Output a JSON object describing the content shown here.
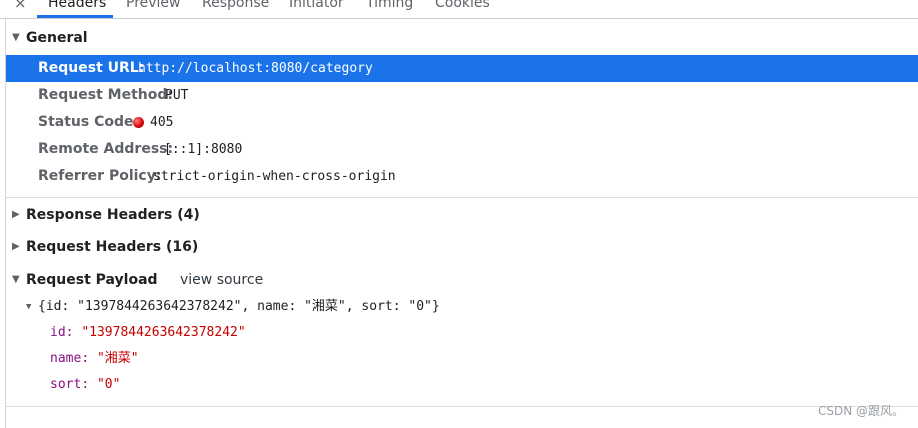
{
  "tabs": [
    {
      "label": "Headers",
      "active": true
    },
    {
      "label": "Preview",
      "active": false
    },
    {
      "label": "Response",
      "active": false
    },
    {
      "label": "Initiator",
      "active": false
    },
    {
      "label": "Timing",
      "active": false
    },
    {
      "label": "Cookies",
      "active": false
    }
  ],
  "close_glyph": "×",
  "general": {
    "title": "General",
    "rows": [
      {
        "key": "Request URL:",
        "value": "http://localhost:8080/category"
      },
      {
        "key": "Request Method:",
        "value": "PUT"
      },
      {
        "key": "Status Code:",
        "value": "405",
        "status_color": "#d30000"
      },
      {
        "key": "Remote Address:",
        "value": "[::1]:8080"
      },
      {
        "key": "Referrer Policy:",
        "value": "strict-origin-when-cross-origin"
      }
    ]
  },
  "response_headers": {
    "title": "Response Headers (4)"
  },
  "request_headers": {
    "title": "Request Headers (16)"
  },
  "request_payload": {
    "title": "Request Payload",
    "view_source": "view source",
    "summary": "{id: \"1397844263642378242\", name: \"湘菜\", sort: \"0\"}",
    "props": [
      {
        "key": "id",
        "value": "\"1397844263642378242\""
      },
      {
        "key": "name",
        "value": "\"湘菜\""
      },
      {
        "key": "sort",
        "value": "\"0\""
      }
    ]
  },
  "colors": {
    "selected_row": "#1a73e8",
    "active_tab_underline": "#1a73e8",
    "payload_key": "#881280",
    "payload_string": "#c80000"
  },
  "icons": {
    "expanded": "▼",
    "collapsed": "▶"
  },
  "watermark": "CSDN @跟风。"
}
